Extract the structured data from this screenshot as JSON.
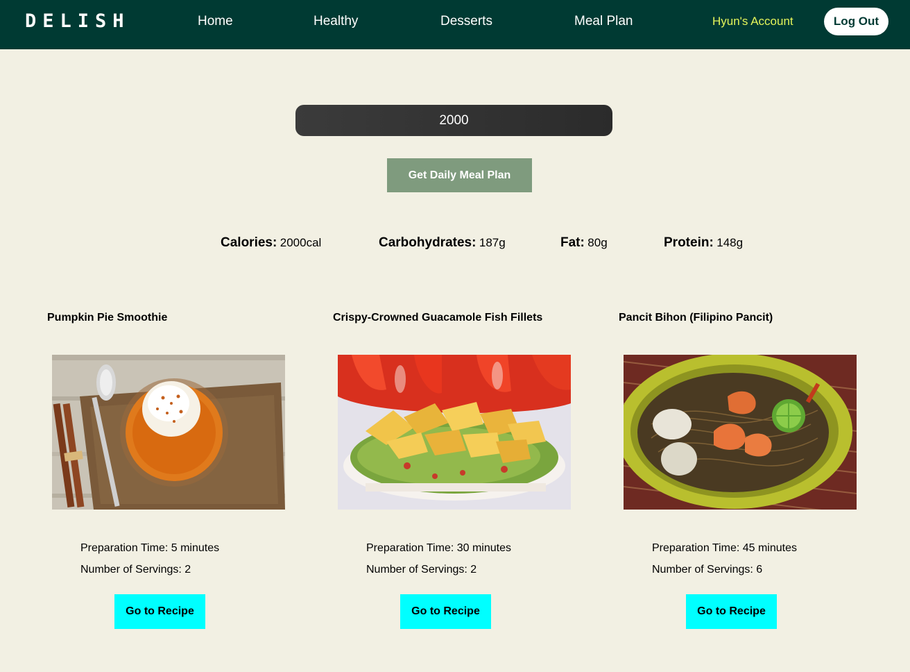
{
  "nav": {
    "logo": "DELISH",
    "links": [
      "Home",
      "Healthy",
      "Desserts",
      "Meal Plan"
    ],
    "account": "Hyun's Account",
    "logout": "Log Out"
  },
  "form": {
    "calories_value": "2000",
    "button_label": "Get Daily Meal Plan"
  },
  "nutrients": [
    {
      "label": "Calories:",
      "value": "2000cal"
    },
    {
      "label": "Carbohydrates:",
      "value": "187g"
    },
    {
      "label": "Fat:",
      "value": "80g"
    },
    {
      "label": "Protein:",
      "value": "148g"
    }
  ],
  "recipes": [
    {
      "title": "Pumpkin Pie Smoothie",
      "prep": "Preparation Time: 5 minutes",
      "servings": "Number of Servings: 2",
      "button": "Go to Recipe"
    },
    {
      "title": "Crispy-Crowned Guacamole Fish Fillets",
      "prep": "Preparation Time: 30 minutes",
      "servings": "Number of Servings: 2",
      "button": "Go to Recipe"
    },
    {
      "title": "Pancit Bihon (Filipino Pancit)",
      "prep": "Preparation Time: 45 minutes",
      "servings": "Number of Servings: 6",
      "button": "Go to Recipe"
    }
  ],
  "colors": {
    "navbar": "#003a33",
    "background": "#f2f0e3",
    "account_link": "#e4f55a",
    "meal_plan_button": "#7f9b7e",
    "recipe_button": "#00ffff"
  }
}
